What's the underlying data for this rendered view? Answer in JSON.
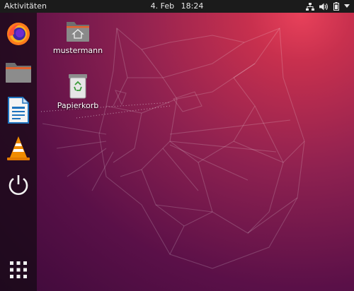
{
  "topbar": {
    "activities_label": "Aktivitäten",
    "date": "4. Feb",
    "time": "18:24"
  },
  "dock": {
    "items": [
      {
        "icon": "firefox-icon"
      },
      {
        "icon": "folder-icon"
      },
      {
        "icon": "libreoffice-writer-icon"
      },
      {
        "icon": "vlc-icon"
      },
      {
        "icon": "power-icon"
      },
      {
        "icon": "app-grid-icon"
      }
    ]
  },
  "desktop": {
    "icons": [
      {
        "label": "mustermann",
        "icon": "home-folder-icon"
      },
      {
        "label": "Papierkorb",
        "icon": "trash-icon"
      }
    ]
  },
  "colors": {
    "topbar": "#1b1b1b",
    "wallpaper_light": "#e8415a",
    "wallpaper_dark": "#3d0a3a"
  }
}
